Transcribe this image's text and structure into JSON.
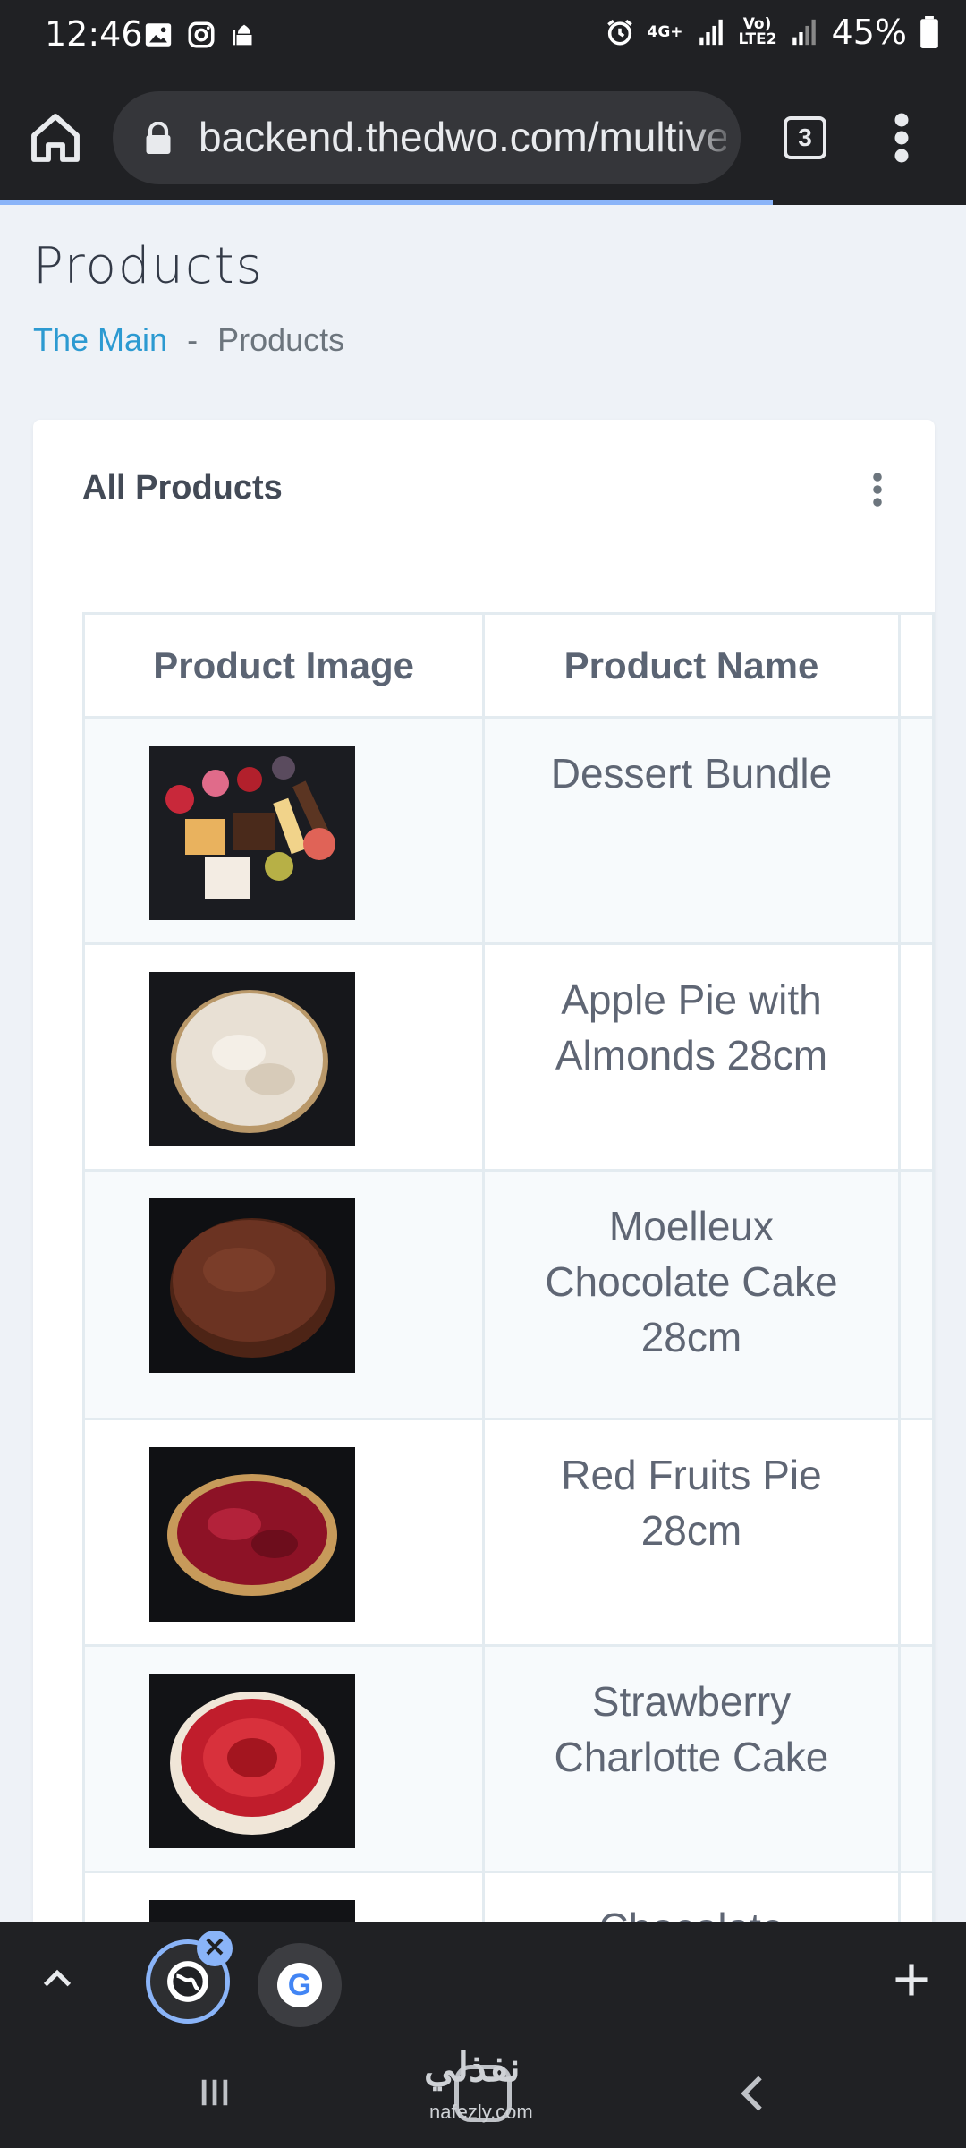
{
  "status_bar": {
    "time": "12:46",
    "network_top": "4G+",
    "network_bottom": "Vo) LTE2",
    "battery": "45%",
    "icons": [
      "gallery-icon",
      "instagram-icon",
      "mosque-icon",
      "alarm-icon",
      "signal-icon",
      "battery-icon"
    ]
  },
  "browser": {
    "url": "backend.thedwo.com/multive",
    "tab_count": "3",
    "load_progress": 0.8
  },
  "page": {
    "title": "Products",
    "breadcrumb": {
      "home": "The Main",
      "separator": "-",
      "current": "Products"
    }
  },
  "card": {
    "title": "All Products",
    "columns": [
      "Product Image",
      "Product Name"
    ],
    "rows": [
      {
        "name": "Dessert Bundle"
      },
      {
        "name": "Apple Pie with Almonds 28cm"
      },
      {
        "name": "Moelleux Chocolate Cake 28cm"
      },
      {
        "name": "Red Fruits Pie 28cm"
      },
      {
        "name": "Strawberry Charlotte Cake"
      },
      {
        "name": "Chocolate"
      }
    ]
  },
  "bottom_bar": {
    "close_glyph": "✕",
    "new_tab_glyph": "+",
    "google_letter": "G"
  },
  "watermark": {
    "brand": "نفذلي",
    "domain": "nafezly.com"
  },
  "colors": {
    "link": "#2c9ad1",
    "chrome_dark": "#202124",
    "accent": "#8ab4f8"
  }
}
